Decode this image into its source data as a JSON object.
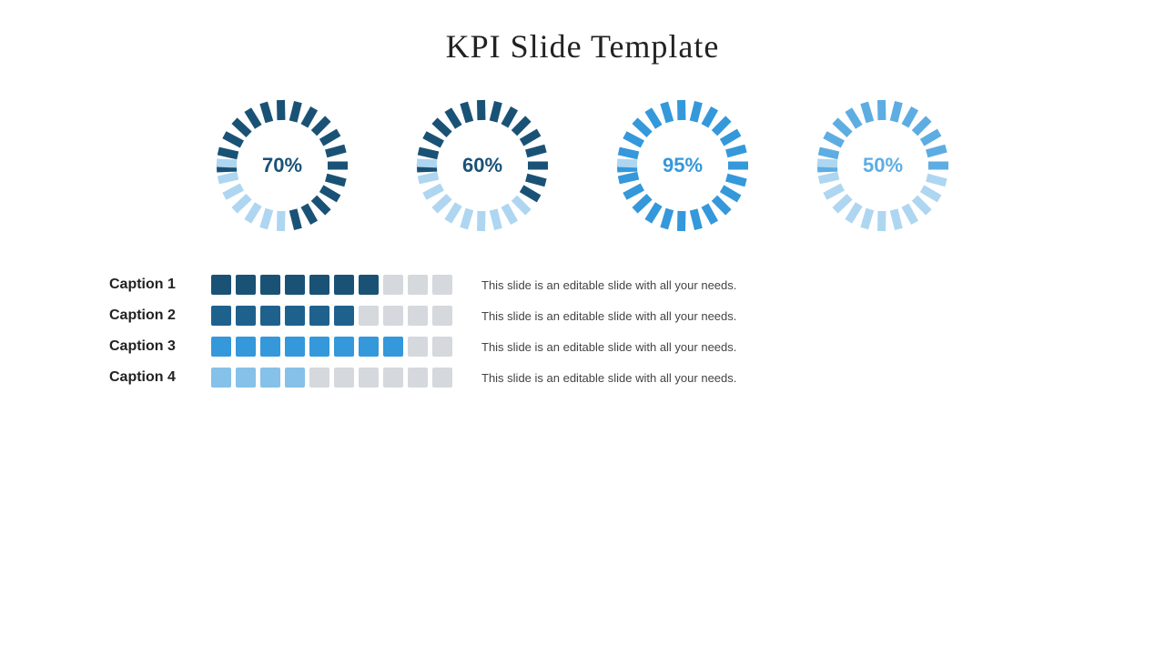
{
  "title": "KPI Slide Template",
  "gauges": [
    {
      "id": "gauge1",
      "percent": 70,
      "label": "70%",
      "color": "#1a5276",
      "lightColor": "#aed6f1",
      "filled": 17
    },
    {
      "id": "gauge2",
      "percent": 60,
      "label": "60%",
      "color": "#1a5276",
      "lightColor": "#aed6f1",
      "filled": 15
    },
    {
      "id": "gauge3",
      "percent": 95,
      "label": "95%",
      "color": "#3498db",
      "lightColor": "#aed6f1",
      "filled": 23
    },
    {
      "id": "gauge4",
      "percent": 50,
      "label": "50%",
      "color": "#5dade2",
      "lightColor": "#aed6f1",
      "filled": 13
    }
  ],
  "legend_rows": [
    {
      "caption": "Caption 1",
      "filled": 7,
      "total": 10,
      "fill_color": "#1a5276",
      "empty_color": "#d5d8dc",
      "description": "This slide is an editable slide with all your needs."
    },
    {
      "caption": "Caption 2",
      "filled": 6,
      "total": 10,
      "fill_color": "#1f618d",
      "empty_color": "#d5d8dc",
      "description": "This slide is an editable slide with all your needs."
    },
    {
      "caption": "Caption 3",
      "filled": 8,
      "total": 10,
      "fill_color": "#3498db",
      "empty_color": "#d5d8dc",
      "description": "This slide is an editable slide with all your needs."
    },
    {
      "caption": "Caption 4",
      "filled": 4,
      "total": 10,
      "fill_color": "#85c1e9",
      "empty_color": "#d5d8dc",
      "description": "This slide is an editable slide with all your needs."
    }
  ]
}
